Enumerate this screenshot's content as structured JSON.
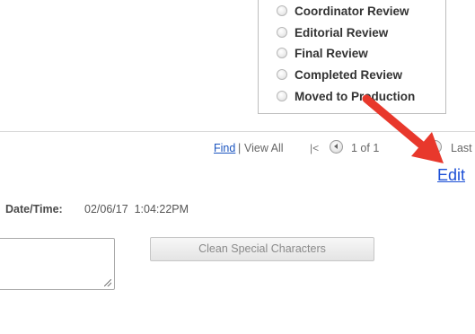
{
  "status_options": [
    {
      "label": "Coordinator Review"
    },
    {
      "label": "Editorial Review"
    },
    {
      "label": "Final Review"
    },
    {
      "label": "Completed Review"
    },
    {
      "label": "Moved to Production"
    }
  ],
  "nav": {
    "find": "Find",
    "separator": "|",
    "view_all": "View All",
    "first": "|<",
    "page_count": "1 of 1",
    "last": "Last"
  },
  "edit_link": "Edit",
  "datetime": {
    "label": "Date/Time:",
    "value": "02/06/17  1:04:22PM"
  },
  "comment": {
    "value": ""
  },
  "buttons": {
    "clean": "Clean Special Characters"
  },
  "colors": {
    "link": "#1b55c0",
    "annotation_arrow": "#e8382c"
  }
}
